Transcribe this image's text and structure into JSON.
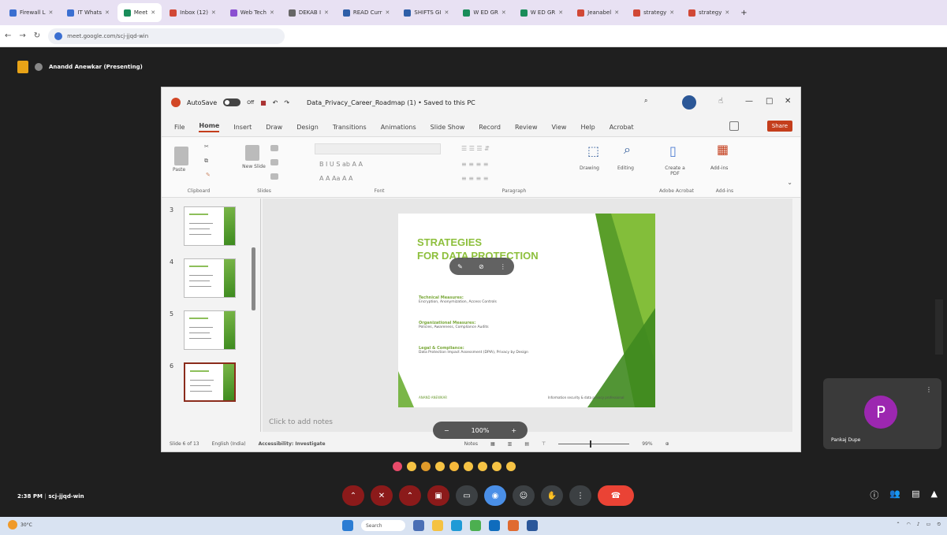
{
  "browser": {
    "tabs": [
      {
        "label": "Firewall L",
        "color": "#3b6fd1"
      },
      {
        "label": "IT Whats",
        "color": "#3b6fd1"
      },
      {
        "label": "Meet",
        "color": "#1a8d5a",
        "active": true
      },
      {
        "label": "Inbox (12)",
        "color": "#d14836"
      },
      {
        "label": "Web Tech",
        "color": "#8a4fd1"
      },
      {
        "label": "DEKAB I",
        "color": "#666666"
      },
      {
        "label": "READ Curr",
        "color": "#2f5fa8"
      },
      {
        "label": "SHIFTS GI",
        "color": "#2f5fa8"
      },
      {
        "label": "W ED GR",
        "color": "#1a8d5a"
      },
      {
        "label": "W ED GR",
        "color": "#1a8d5a"
      },
      {
        "label": "Jeanabel",
        "color": "#d14836"
      },
      {
        "label": "strategy",
        "color": "#d14836"
      },
      {
        "label": "strategy",
        "color": "#d14836"
      }
    ],
    "url": "meet.google.com/scj-jjqd-win"
  },
  "meet": {
    "presenter": "Anandd Anewkar (Presenting)",
    "time": "2:38 PM",
    "meeting_code": "scj-jjqd-win",
    "participant": {
      "initial": "P",
      "name": "Pankaj Dupe"
    }
  },
  "ppt": {
    "autosave": "AutoSave",
    "toggle": "Off",
    "doc_title": "Data_Privacy_Career_Roadmap (1) • Saved to this PC",
    "tabs": [
      "File",
      "Home",
      "Insert",
      "Draw",
      "Design",
      "Transitions",
      "Animations",
      "Slide Show",
      "Record",
      "Review",
      "View",
      "Help",
      "Acrobat"
    ],
    "share": "Share",
    "groups": {
      "clipboard": "Clipboard",
      "slides": "Slides",
      "font": "Font",
      "paragraph": "Paragraph",
      "adobe": "Adobe Acrobat",
      "addins": "Add-ins",
      "paste": "Paste",
      "new_slide": "New Slide",
      "drawing": "Drawing",
      "editing": "Editing",
      "create_pdf": "Create a PDF",
      "add_ins": "Add-ins"
    },
    "slide_numbers": [
      "3",
      "4",
      "5",
      "6"
    ],
    "slide": {
      "title_line1": "STRATEGIES",
      "title_line2": "FOR DATA PROTECTION",
      "bullets": [
        {
          "head": "Technical Measures:",
          "body": "Encryption, Anonymization, Access Controls"
        },
        {
          "head": "Organizational Measures:",
          "body": "Policies, Awareness, Compliance Audits"
        },
        {
          "head": "Legal & Compliance:",
          "body": "Data Protection Impact Assessment (DPIA), Privacy by Design"
        }
      ],
      "footer_left": "ANAND ANEWKAR",
      "footer_right": "Information security & data privacy professional"
    },
    "notes_placeholder": "Click to add notes",
    "zoom": "100%",
    "status": {
      "slide_count": "Slide 6 of 13",
      "language": "English (India)",
      "accessibility": "Accessibility: Investigate",
      "notes": "Notes",
      "zoom_pct": "99%"
    }
  },
  "taskbar": {
    "weather": "30°C",
    "search": "Search"
  }
}
